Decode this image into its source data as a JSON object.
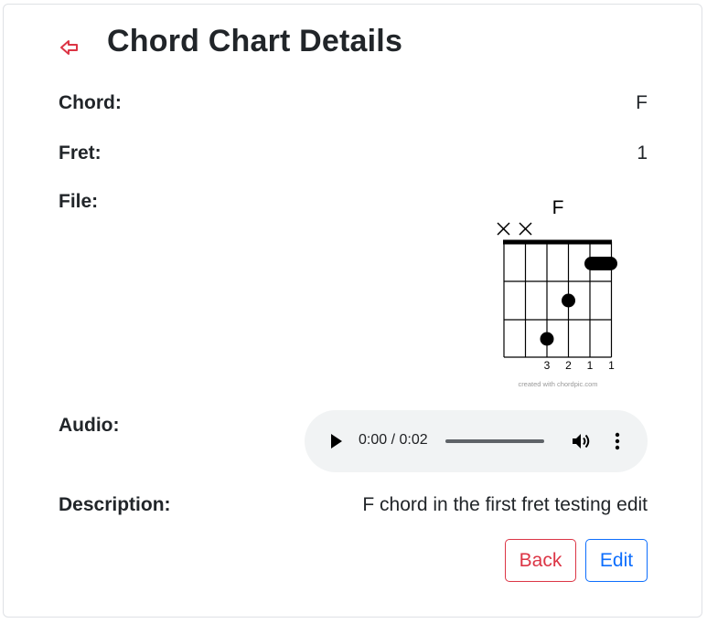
{
  "header": {
    "title": "Chord Chart Details",
    "back_icon": "back-arrow-icon"
  },
  "details": {
    "chord_label": "Chord:",
    "chord_value": "F",
    "fret_label": "Fret:",
    "fret_value": "1",
    "file_label": "File:",
    "audio_label": "Audio:",
    "description_label": "Description:",
    "description_value": "F chord in the first fret testing edit"
  },
  "chord_diagram": {
    "name": "F",
    "muted_strings": [
      "×",
      "×"
    ],
    "finger_numbers": [
      "3",
      "2",
      "1",
      "1"
    ],
    "credit": "created with chordpic.com"
  },
  "audio_player": {
    "time": "0:00 / 0:02",
    "progress": 0,
    "icons": [
      "play-icon",
      "volume-icon",
      "more-options-icon"
    ]
  },
  "buttons": {
    "back_label": "Back",
    "edit_label": "Edit"
  },
  "colors": {
    "back_accent": "#dc3545",
    "edit_accent": "#0d6efd",
    "text": "#212529",
    "player_bg": "#f1f3f4"
  }
}
